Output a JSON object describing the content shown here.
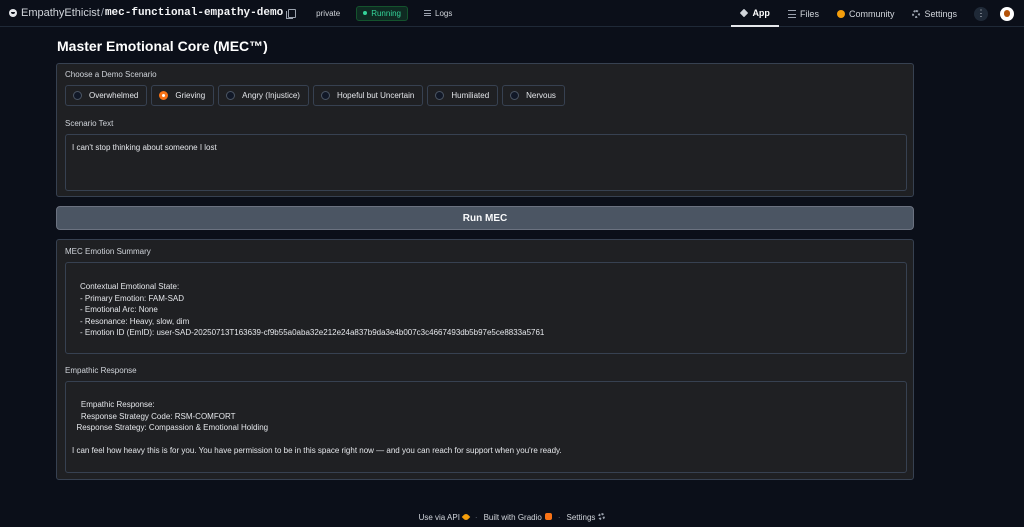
{
  "header": {
    "owner": "EmpathyEthicist",
    "separator": "/",
    "repo": "mec-functional-empathy-demo",
    "visibility": "private",
    "status": "Running",
    "logs_label": "Logs",
    "nav": [
      {
        "label": "App",
        "icon": "app-icon",
        "active": true
      },
      {
        "label": "Files",
        "icon": "files-icon",
        "active": false
      },
      {
        "label": "Community",
        "icon": "community-icon",
        "active": false
      },
      {
        "label": "Settings",
        "icon": "settings-icon",
        "active": false
      }
    ],
    "kebab_label": "⋮"
  },
  "main": {
    "title": "Master Emotional Core (MEC™)",
    "scenario_label": "Choose a Demo Scenario",
    "scenarios": [
      {
        "label": "Overwhelmed",
        "selected": false
      },
      {
        "label": "Grieving",
        "selected": true
      },
      {
        "label": "Angry (Injustice)",
        "selected": false
      },
      {
        "label": "Hopeful but Uncertain",
        "selected": false
      },
      {
        "label": "Humiliated",
        "selected": false
      },
      {
        "label": "Nervous",
        "selected": false
      }
    ],
    "scenario_text_label": "Scenario Text",
    "scenario_text_value": "I can't stop thinking about someone I lost",
    "run_button": "Run MEC",
    "summary_label": "MEC Emotion Summary",
    "summary_lines": [
      "Contextual Emotional State:",
      "- Primary Emotion: FAM-SAD",
      "- Emotional Arc: None",
      "- Resonance: Heavy, slow, dim",
      "- Emotion ID (EmID): user-SAD-20250713T163639-cf9b55a0aba32e212e24a837b9da3e4b007c3c4667493db5b97e5ce8833a5761"
    ],
    "response_label": "Empathic Response",
    "response_lines": [
      "    Empathic Response:",
      "    Response Strategy Code: RSM-COMFORT",
      "  Response Strategy: Compassion & Emotional Holding"
    ],
    "response_message": "I can feel how heavy this is for you. You have permission to be in this space right now — and you can reach for support when you're ready."
  },
  "footer": {
    "api": "Use via API",
    "built": "Built with Gradio",
    "settings": "Settings",
    "separator": "·"
  },
  "colors": {
    "background": "#0b0f19",
    "panel": "#1f2023",
    "accent": "#f97316",
    "running": "#34d399"
  }
}
